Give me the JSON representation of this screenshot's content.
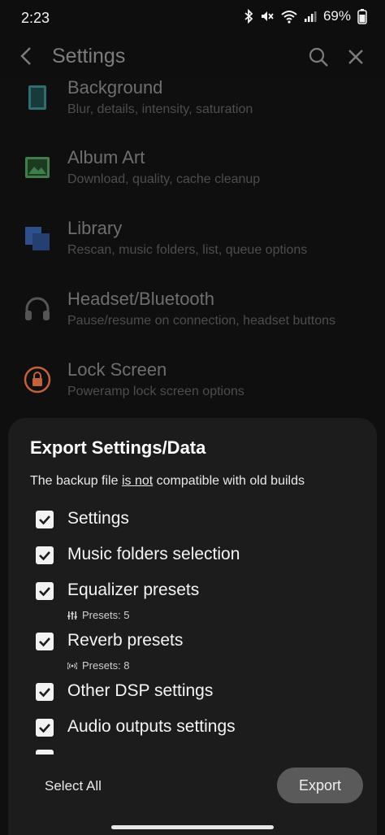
{
  "status": {
    "time": "2:23",
    "battery": "69%",
    "icons": [
      "bluetooth-icon",
      "mute-icon",
      "wifi-icon",
      "signal-icon",
      "battery-icon"
    ]
  },
  "appbar": {
    "title": "Settings"
  },
  "settings_items": [
    {
      "title": "Background",
      "subtitle": "Blur, details, intensity, saturation",
      "icon": "background-icon"
    },
    {
      "title": "Album Art",
      "subtitle": "Download, quality, cache cleanup",
      "icon": "image-icon"
    },
    {
      "title": "Library",
      "subtitle": "Rescan, music folders, list, queue options",
      "icon": "library-icon"
    },
    {
      "title": "Headset/Bluetooth",
      "subtitle": "Pause/resume on connection, headset buttons",
      "icon": "headphones-icon"
    },
    {
      "title": "Lock Screen",
      "subtitle": "Poweramp lock screen options",
      "icon": "lock-icon"
    }
  ],
  "sheet": {
    "title": "Export Settings/Data",
    "note_before": "The backup file ",
    "note_underlined": "is not",
    "note_after": " compatible with old builds",
    "options": [
      {
        "label": "Settings",
        "checked": true
      },
      {
        "label": "Music folders selection",
        "checked": true
      },
      {
        "label": "Equalizer presets",
        "checked": true,
        "sub": "Presets: 5"
      },
      {
        "label": "Reverb presets",
        "checked": true,
        "sub": "Presets: 8"
      },
      {
        "label": "Other DSP settings",
        "checked": true
      },
      {
        "label": "Audio outputs settings",
        "checked": true
      }
    ],
    "select_all": "Select All",
    "export": "Export"
  },
  "colors": {
    "sheet_bg": "#1c1c1c",
    "export_button_bg": "#5a5a5a",
    "album_art_icon": "#3f7d4a",
    "library_icon": "#2d4f8c",
    "lock_icon": "#c2623a",
    "background_icon": "#2f6e70"
  }
}
